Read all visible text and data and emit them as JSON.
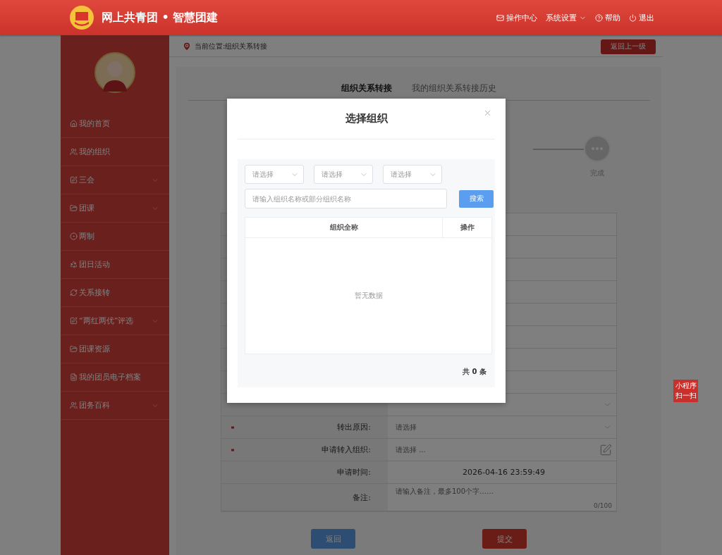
{
  "header": {
    "title": "网上共青团 • 智慧团建",
    "nav": [
      {
        "label": "操作中心",
        "kind": "mail"
      },
      {
        "label": "系统设置",
        "kind": "dropdown"
      },
      {
        "label": "帮助",
        "kind": "help"
      },
      {
        "label": "退出",
        "kind": "logout"
      }
    ]
  },
  "sidebar": {
    "items": [
      {
        "label": "我的首页",
        "kind": "home",
        "expandable": false
      },
      {
        "label": "我的组织",
        "kind": "group",
        "expandable": false
      },
      {
        "label": "三会",
        "kind": "edit",
        "expandable": true
      },
      {
        "label": "团课",
        "kind": "folder",
        "expandable": true
      },
      {
        "label": "两制",
        "kind": "target",
        "expandable": false
      },
      {
        "label": "团日活动",
        "kind": "recycle",
        "expandable": false
      },
      {
        "label": "关系接转",
        "kind": "refresh",
        "expandable": false
      },
      {
        "label": "“两红两优”评选",
        "kind": "edit",
        "expandable": true
      },
      {
        "label": "团课资源",
        "kind": "folder",
        "expandable": false
      },
      {
        "label": "我的团员电子档案",
        "kind": "file",
        "expandable": false
      },
      {
        "label": "团务百科",
        "kind": "group",
        "expandable": true
      }
    ]
  },
  "breadcrumb": {
    "text": "当前位置:组织关系转接",
    "back_button": "返回上一级"
  },
  "tabs": [
    {
      "label": "组织关系转接",
      "selected": true
    },
    {
      "label": "我的组织关系转接历史",
      "selected": false
    }
  ],
  "steps": [
    {
      "label": "完成"
    }
  ],
  "form": {
    "rows": [
      {
        "kind": "blank"
      },
      {
        "kind": "blank"
      },
      {
        "kind": "blank"
      },
      {
        "kind": "blank"
      },
      {
        "kind": "blank"
      },
      {
        "kind": "blank"
      },
      {
        "kind": "blank"
      },
      {
        "kind": "blank"
      },
      {
        "kind": "select"
      },
      {
        "kind": "select",
        "label": "转出原因:",
        "placeholder": "请选择",
        "required": true
      },
      {
        "kind": "picker",
        "label": "申请转入组织:",
        "placeholder": "请选择 ...",
        "required": true
      },
      {
        "kind": "text",
        "label": "申请时间:",
        "value": "2026-04-16 23:59:49",
        "required": false
      },
      {
        "kind": "textarea",
        "label": "备注:",
        "placeholder": "请输入备注，最多100个字……",
        "counter": "0/100",
        "required": false
      }
    ],
    "buttons": [
      {
        "label": "返回",
        "kind": "back"
      },
      {
        "label": "提交",
        "kind": "submit"
      }
    ]
  },
  "float_badge": {
    "lines": [
      "小程序",
      "扫一扫"
    ]
  },
  "modal": {
    "title": "选择组织",
    "selects": [
      "请选择",
      "请选择",
      "请选择"
    ],
    "search_placeholder": "请输入组织名称或部分组织名称",
    "search_button": "搜索",
    "columns": [
      "组织全称",
      "操作"
    ],
    "empty_text": "暂无数据",
    "total": "共 0 条"
  }
}
